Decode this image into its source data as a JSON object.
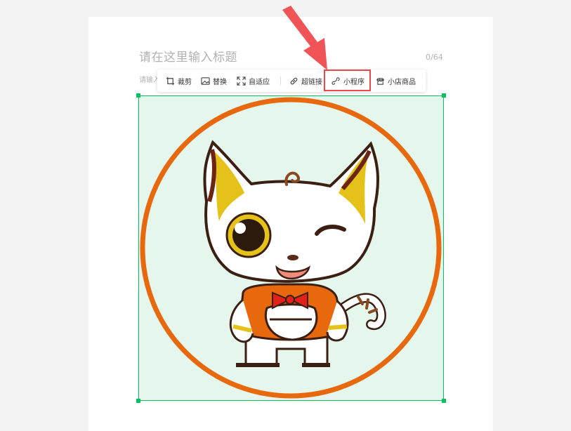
{
  "editor": {
    "title_placeholder": "请在这里输入标题",
    "title_counter": "0/64",
    "author_placeholder": "请输入作者"
  },
  "toolbar": {
    "items": [
      {
        "label": "裁剪",
        "icon": "crop-icon"
      },
      {
        "label": "替换",
        "icon": "image-icon"
      },
      {
        "label": "自适应",
        "icon": "expand-icon"
      },
      {
        "label": "超链接",
        "icon": "link-icon"
      },
      {
        "label": "小程序",
        "icon": "mini-program-icon",
        "highlighted": true
      },
      {
        "label": "小店商品",
        "icon": "shop-icon"
      }
    ]
  },
  "colors": {
    "selection": "#07c160",
    "highlight": "#e8494a",
    "arrow": "#f05456",
    "image_bg": "#e5f6ec",
    "ring": "#e8690d"
  }
}
